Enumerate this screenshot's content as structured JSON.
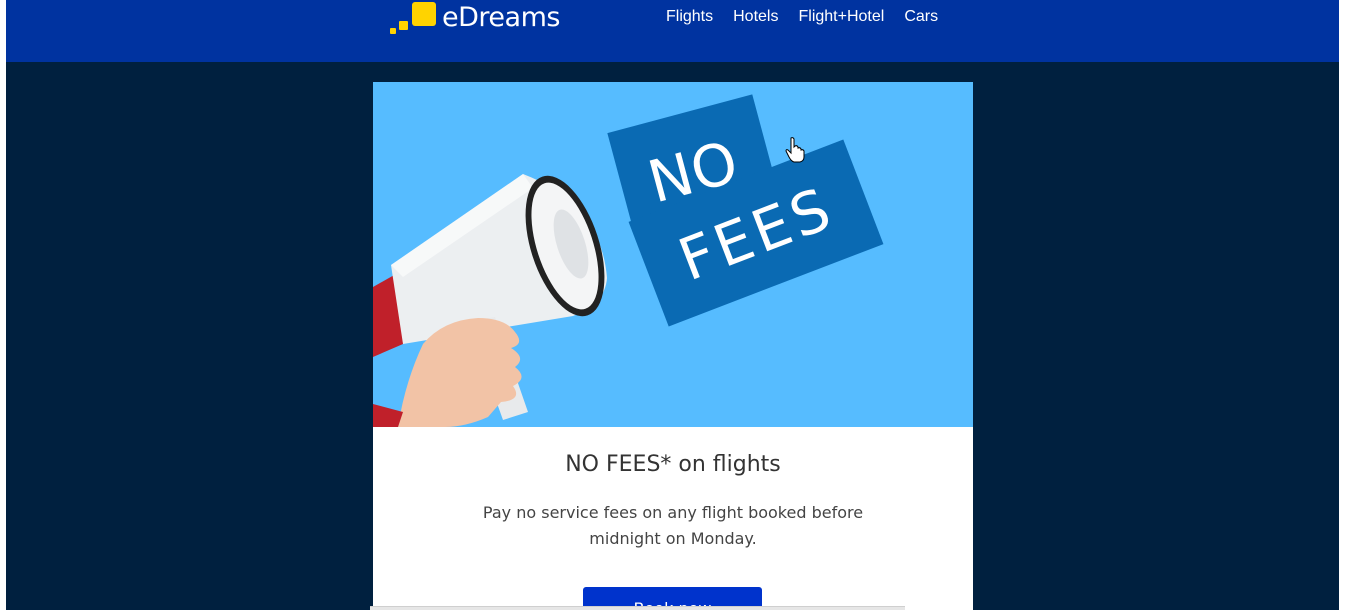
{
  "brand": {
    "name": "eDreams"
  },
  "nav": {
    "items": [
      {
        "label": "Flights"
      },
      {
        "label": "Hotels"
      },
      {
        "label": "Flight+Hotel"
      },
      {
        "label": "Cars"
      }
    ]
  },
  "hero": {
    "sign_line1": "NO",
    "sign_line2": "FEES",
    "image_subject": "hand-holding-megaphone"
  },
  "promo": {
    "headline": "NO FEES* on flights",
    "body": "Pay no service fees on any flight booked before midnight on Monday.",
    "cta_label": "Book now"
  },
  "colors": {
    "topbar": "#0033a0",
    "page_background": "#00203f",
    "hero_background": "#56bcff",
    "sign_blue": "#0a6ab3",
    "logo_yellow": "#ffd300",
    "cta_blue": "#0033cc"
  }
}
